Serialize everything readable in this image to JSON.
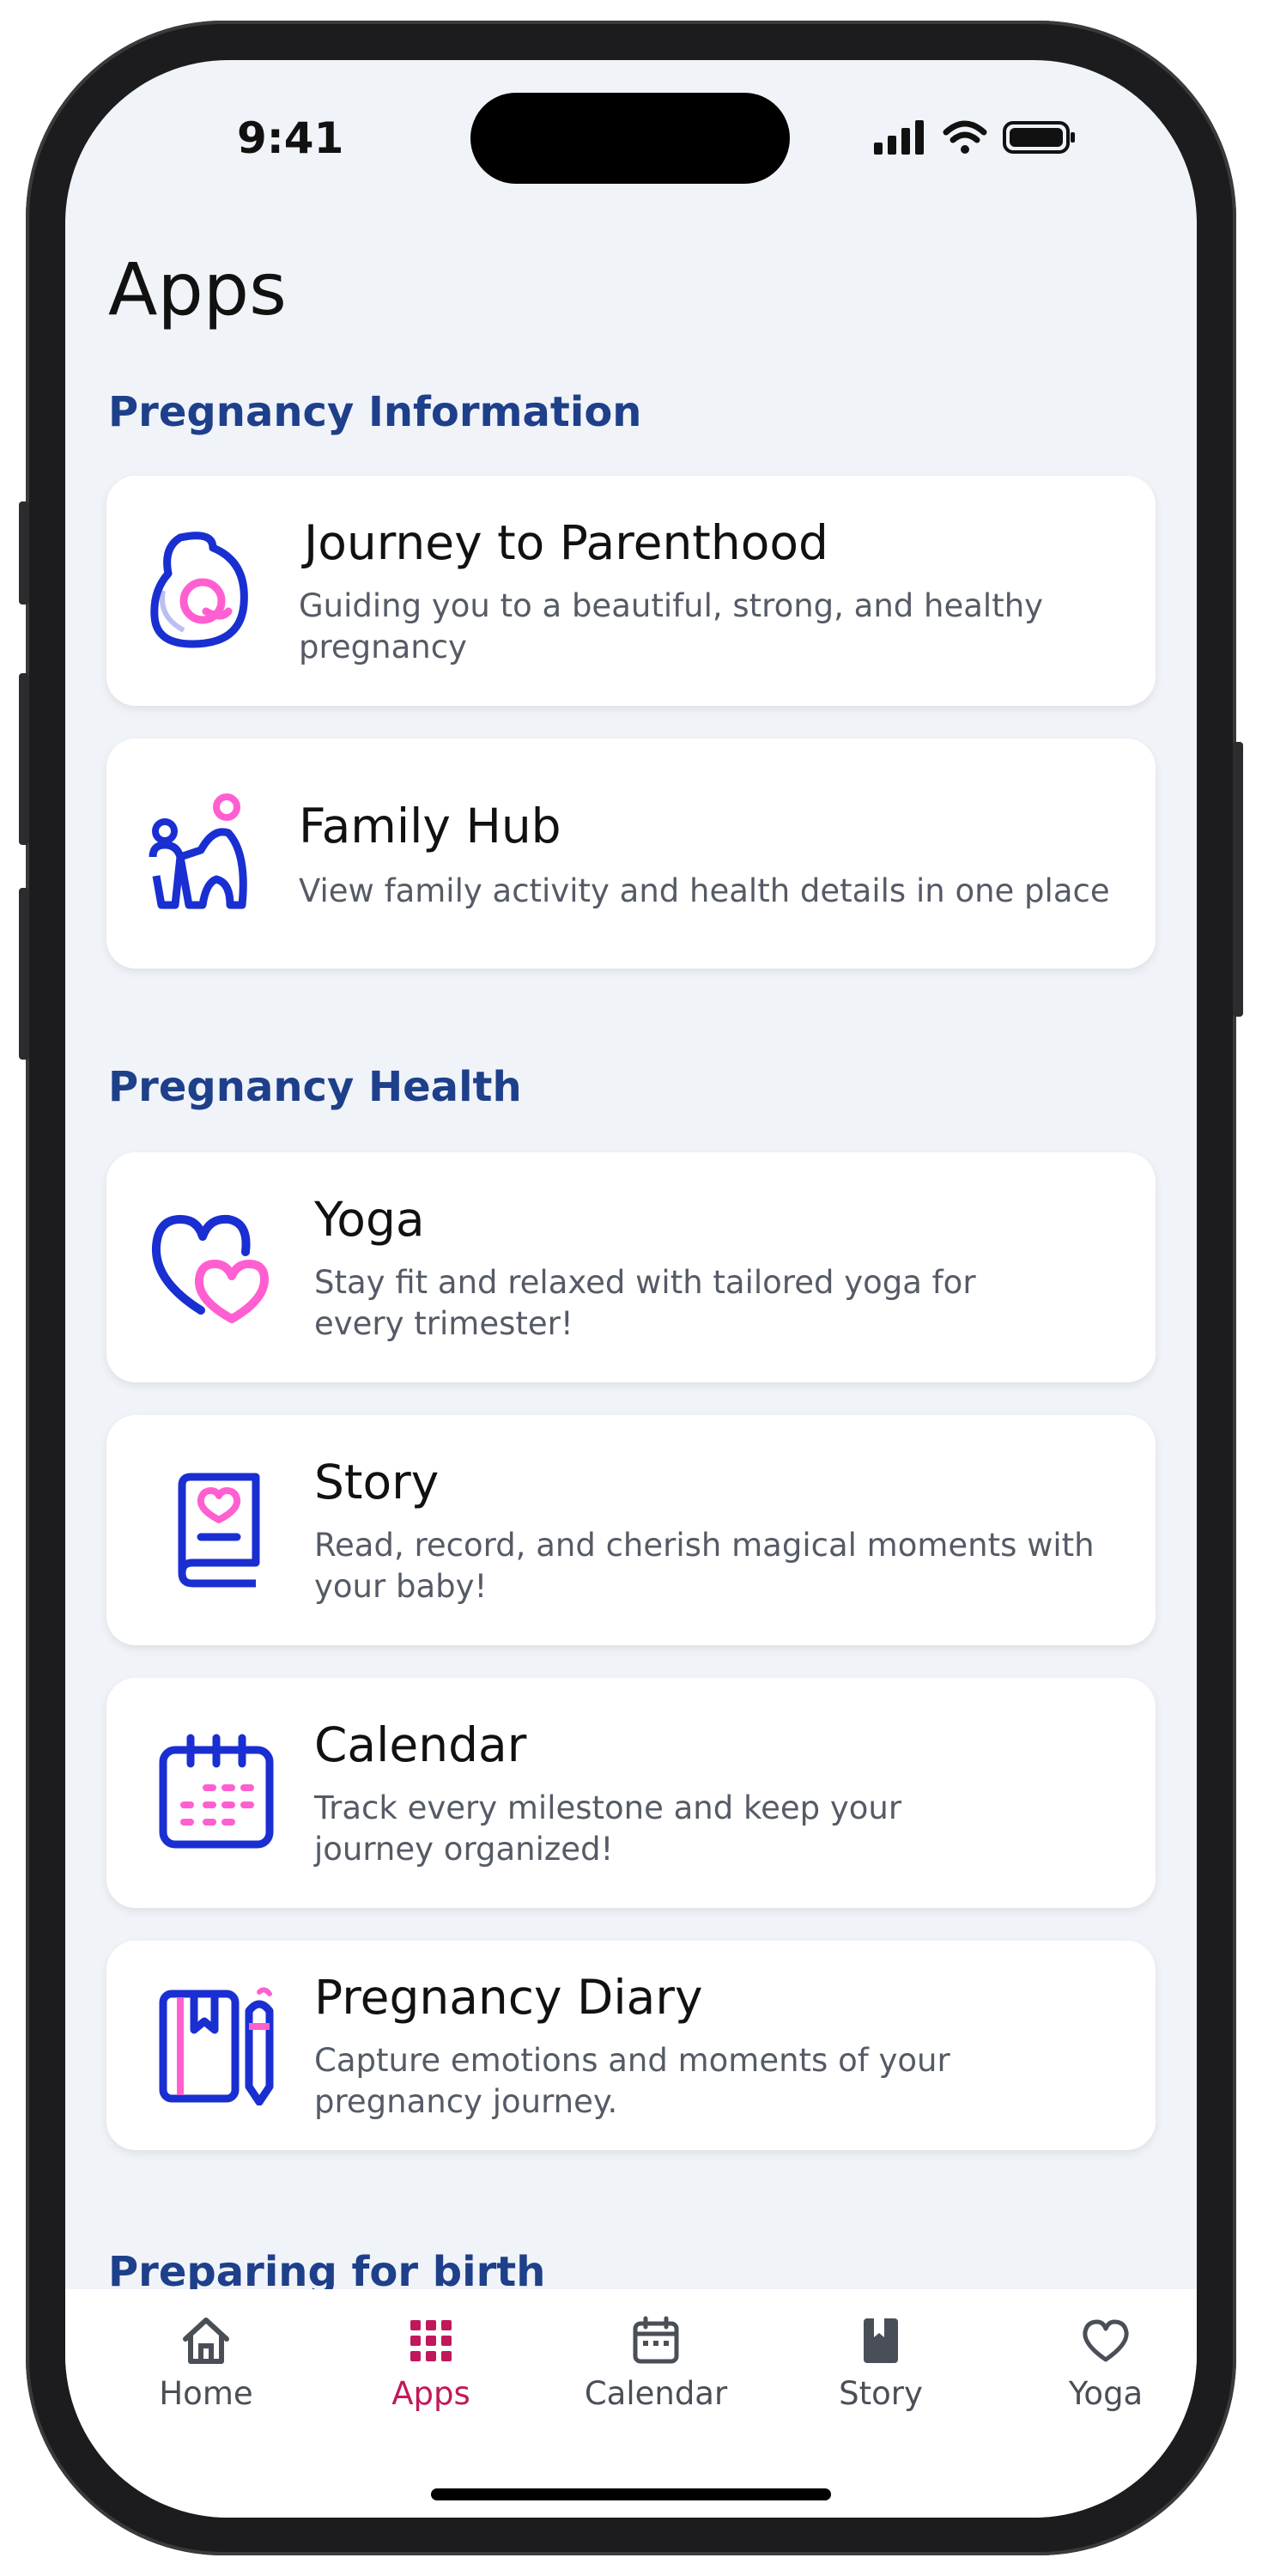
{
  "status": {
    "time": "9:41"
  },
  "page_title": "Apps",
  "sections": [
    {
      "title": "Pregnancy Information",
      "cards": [
        {
          "title": "Journey to Parenthood",
          "desc": "Guiding you to a beautiful, strong, and healthy pregnancy",
          "icon": "pregnancy-icon"
        },
        {
          "title": "Family Hub",
          "desc": "View family activity and health details in one place",
          "icon": "family-icon"
        }
      ]
    },
    {
      "title": "Pregnancy Health",
      "cards": [
        {
          "title": "Yoga",
          "desc": "Stay fit and relaxed with tailored yoga for every trimester!",
          "icon": "hearts-icon"
        },
        {
          "title": "Story",
          "desc": "Read, record, and cherish magical moments with your baby!",
          "icon": "book-heart-icon"
        },
        {
          "title": "Calendar",
          "desc": "Track every milestone and keep your journey organized!",
          "icon": "calendar-icon"
        },
        {
          "title": "Pregnancy Diary",
          "desc": "Capture emotions and moments of your pregnancy journey.",
          "icon": "diary-pen-icon"
        }
      ]
    },
    {
      "title": "Preparing for birth"
    }
  ],
  "nav": [
    {
      "label": "Home",
      "icon": "home-icon"
    },
    {
      "label": "Apps",
      "icon": "grid-icon",
      "active": true
    },
    {
      "label": "Calendar",
      "icon": "calendar-icon"
    },
    {
      "label": "Story",
      "icon": "book-icon"
    },
    {
      "label": "Yoga",
      "icon": "heart-icon"
    }
  ],
  "colors": {
    "accent": "#c2185b",
    "section": "#1e3f8a",
    "icon_blue": "#1a2fd1",
    "icon_pink": "#ff5fd0"
  }
}
